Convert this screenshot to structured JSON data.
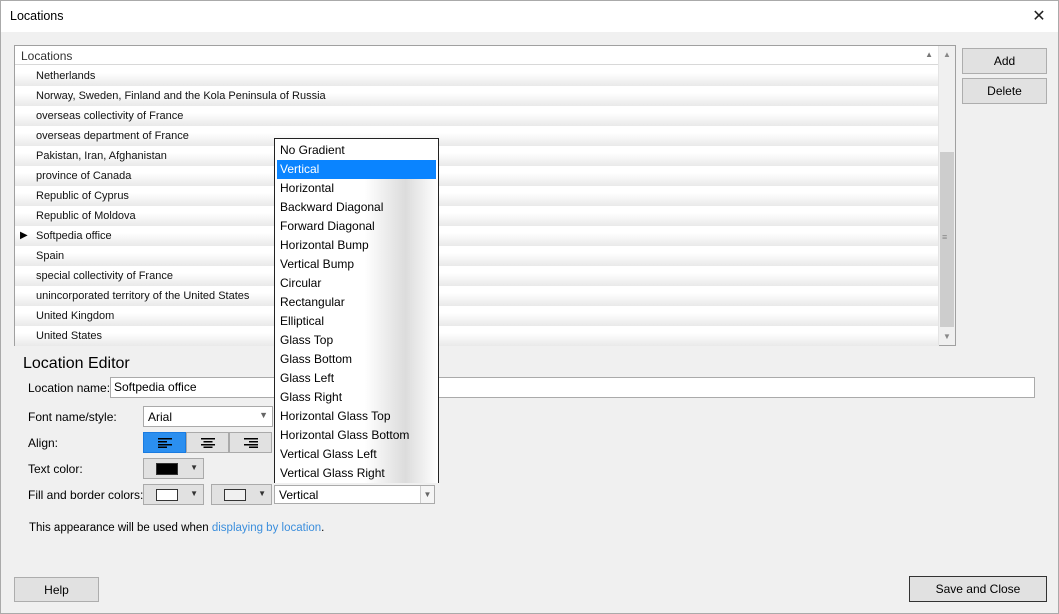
{
  "window": {
    "title": "Locations",
    "close_icon": "close-icon"
  },
  "grid": {
    "header": "Locations",
    "rows": [
      "Netherlands",
      "Norway, Sweden, Finland and the Kola Peninsula of Russia",
      "overseas collectivity of France",
      "overseas department of France",
      "Pakistan, Iran, Afghanistan",
      "province of Canada",
      "Republic of Cyprus",
      "Republic of Moldova",
      "Softpedia office",
      "Spain",
      "special collectivity of France",
      "unincorporated territory of the United States",
      "United Kingdom",
      "United States"
    ],
    "current_row_index": 8
  },
  "buttons": {
    "add": "Add",
    "delete": "Delete",
    "help": "Help",
    "save_close": "Save and Close"
  },
  "editor": {
    "title": "Location Editor",
    "name_label": "Location name:",
    "name_value": "Softpedia office",
    "font_label": "Font name/style:",
    "font_value": "Arial",
    "align_label": "Align:",
    "align_options": [
      "left",
      "center",
      "right"
    ],
    "align_selected": "left",
    "text_color_label": "Text color:",
    "text_color": "#000000",
    "fill_border_label": "Fill and border colors:",
    "fill_color": "#ffffff",
    "border_color": "#f0f0f0",
    "gradient_value": "Vertical",
    "info_prefix": "This appearance will be used when ",
    "info_link": "displaying by location",
    "info_suffix": "."
  },
  "gradient_dropdown": {
    "options": [
      "No Gradient",
      "Vertical",
      "Horizontal",
      "Backward Diagonal",
      "Forward Diagonal",
      "Horizontal Bump",
      "Vertical Bump",
      "Circular",
      "Rectangular",
      "Elliptical",
      "Glass Top",
      "Glass Bottom",
      "Glass Left",
      "Glass Right",
      "Horizontal Glass Top",
      "Horizontal Glass Bottom",
      "Vertical Glass Left",
      "Vertical Glass Right"
    ],
    "selected_index": 1
  },
  "colors": {
    "accent": "#0a84ff",
    "active_align": "#2b8ff0",
    "link": "#3b8edc"
  }
}
